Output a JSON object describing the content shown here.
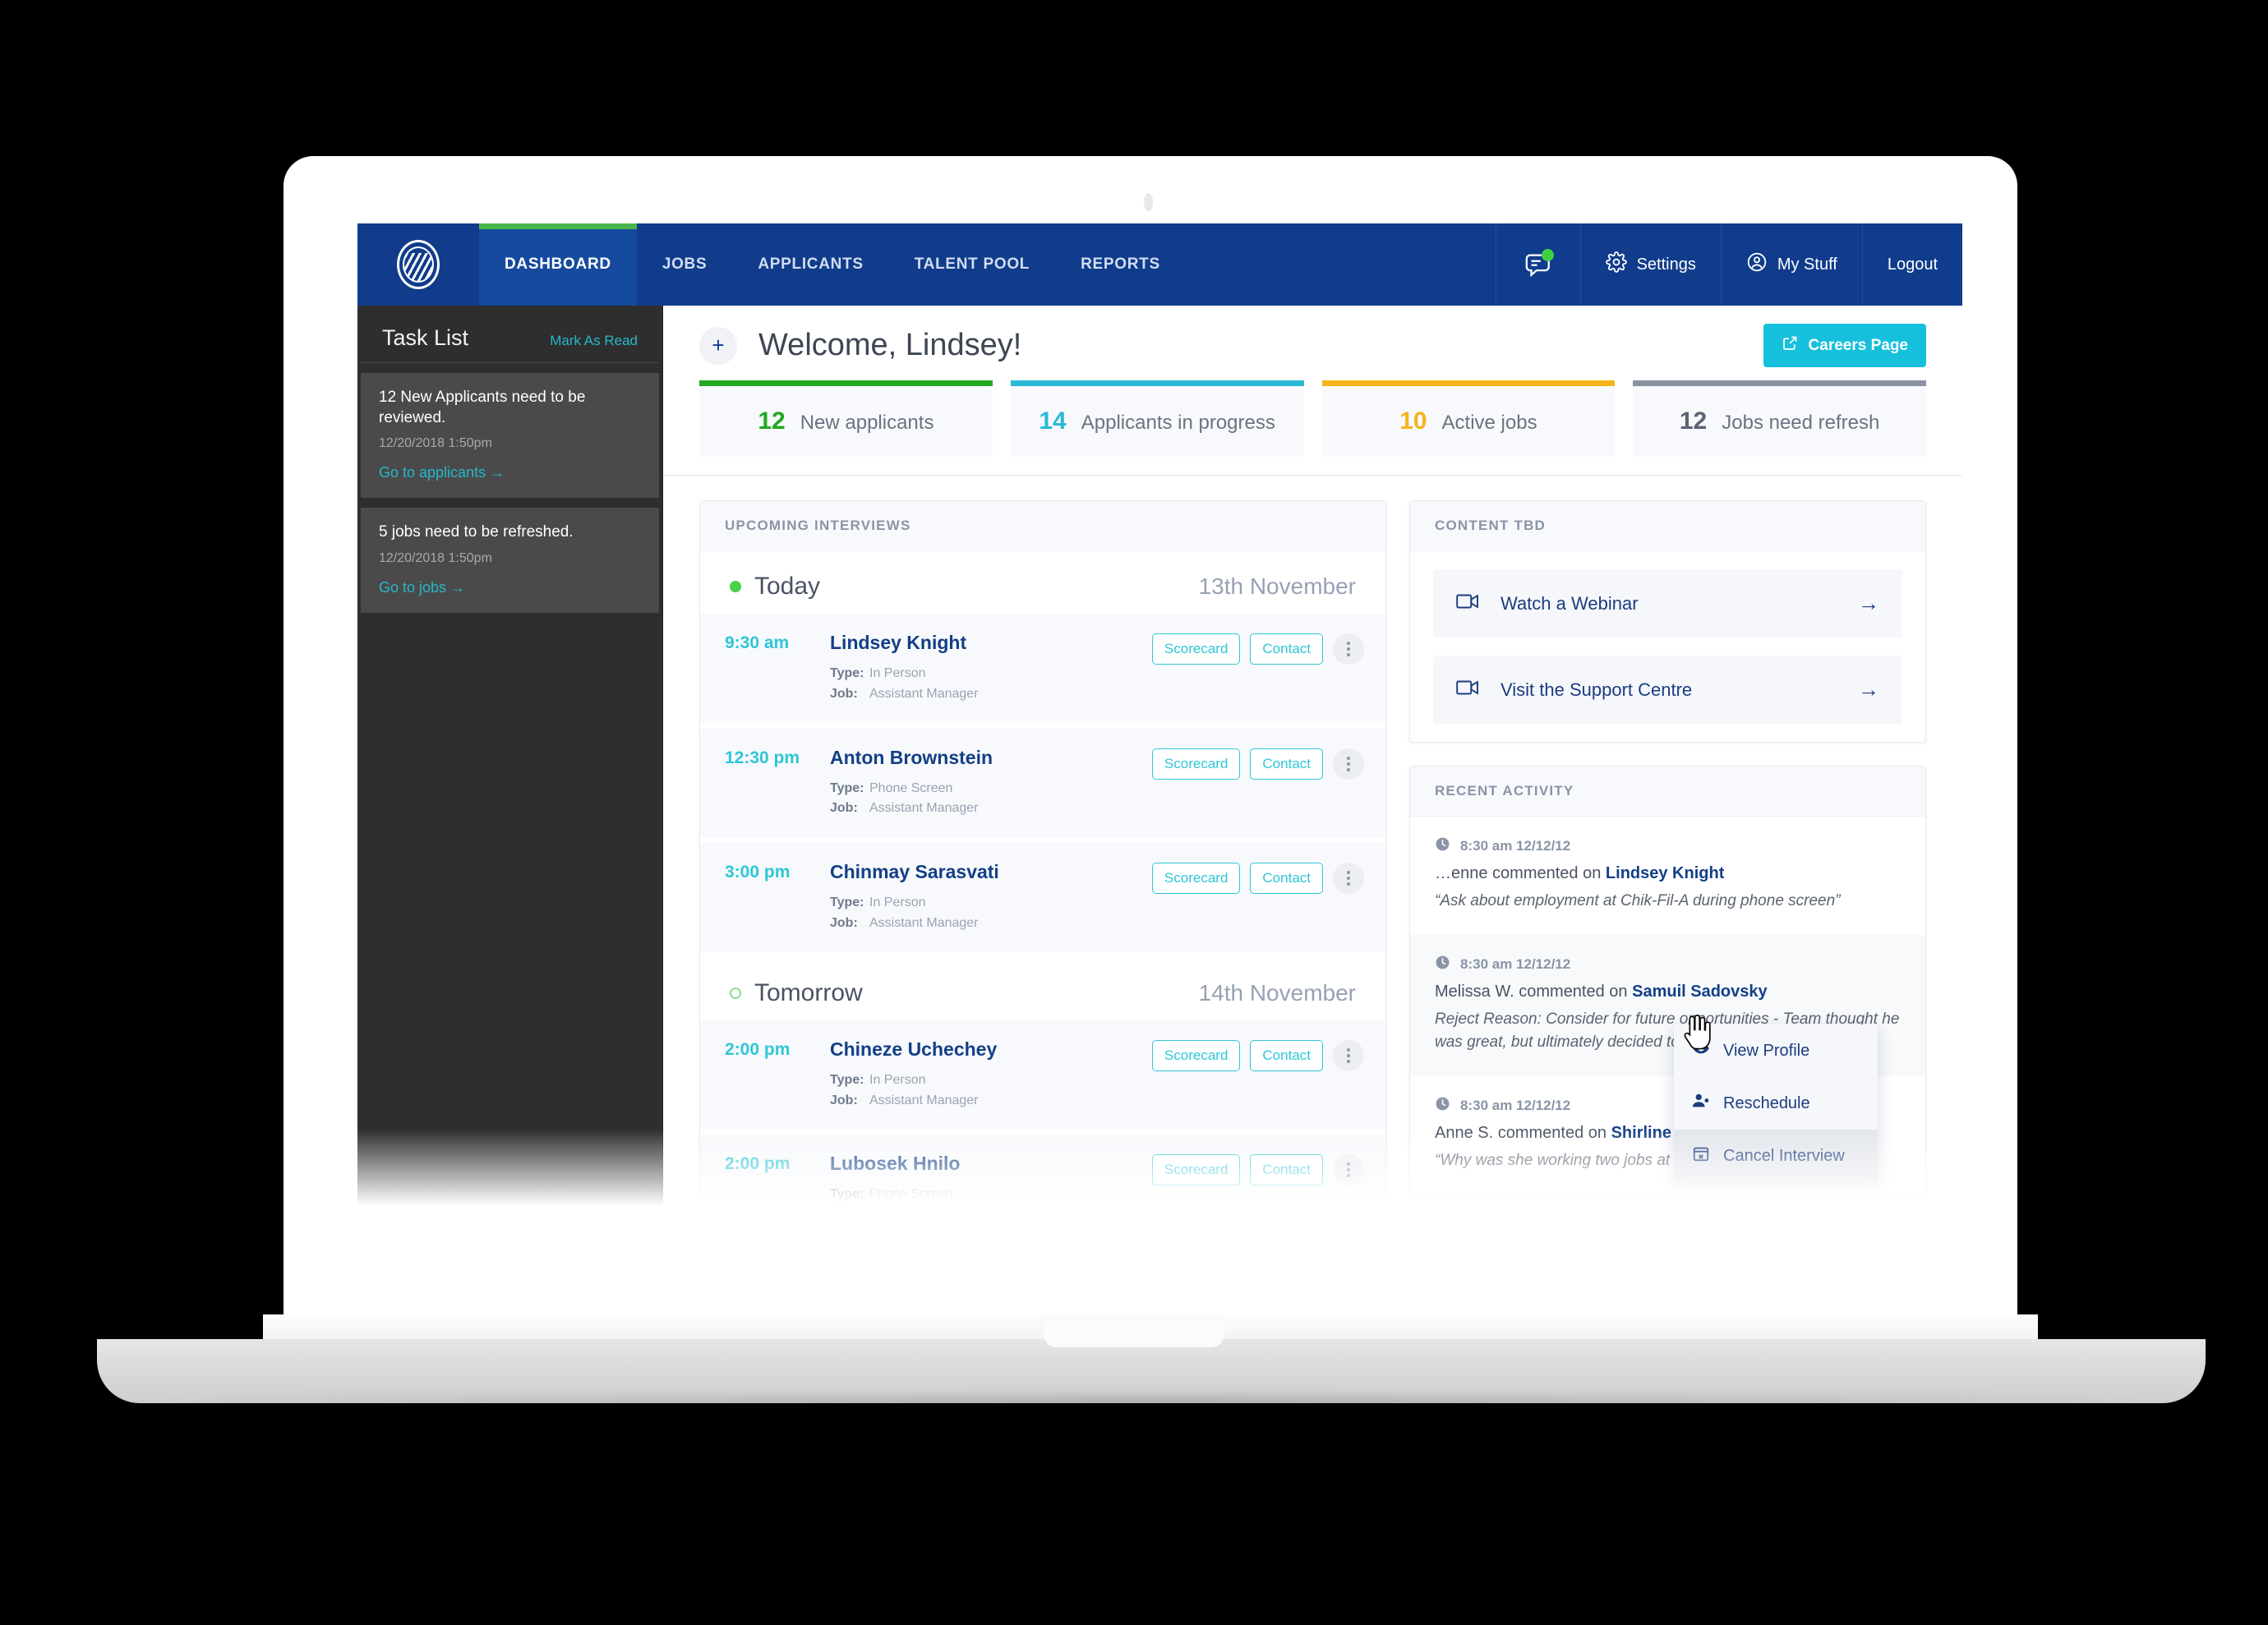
{
  "nav": {
    "logo_icon": "company-logo-icon",
    "items": [
      {
        "label": "DASHBOARD",
        "active": true
      },
      {
        "label": "JOBS",
        "active": false
      },
      {
        "label": "APPLICANTS",
        "active": false
      },
      {
        "label": "TALENT POOL",
        "active": false
      },
      {
        "label": "REPORTS",
        "active": false
      }
    ],
    "right": [
      {
        "label": "",
        "icon": "chat-bubble-icon",
        "badge": true
      },
      {
        "label": "Settings",
        "icon": "gear-icon",
        "badge": false
      },
      {
        "label": "My Stuff",
        "icon": "user-circle-icon",
        "badge": false
      },
      {
        "label": "Logout",
        "icon": "",
        "badge": false
      }
    ]
  },
  "sidebar": {
    "title": "Task List",
    "mark_as_read": "Mark As Read",
    "tasks": [
      {
        "text": "12 New Applicants need to be reviewed.",
        "date": "12/20/2018 1:50pm",
        "link": "Go to applicants →"
      },
      {
        "text": "5 jobs need to be refreshed.",
        "date": "12/20/2018 1:50pm",
        "link": "Go to jobs →"
      }
    ]
  },
  "header": {
    "add_icon": "plus-icon",
    "title": "Welcome, Lindsey!",
    "careers_button": "Careers Page",
    "careers_icon": "external-link-icon"
  },
  "stats": [
    {
      "value": "12",
      "label": "New applicants",
      "color": "#22a922"
    },
    {
      "value": "14",
      "label": "Applicants in progress",
      "color": "#2bb9d6"
    },
    {
      "value": "10",
      "label": "Active jobs",
      "color": "#f5b41a"
    },
    {
      "value": "12",
      "label": "Jobs need refresh",
      "color": "#5a6472"
    }
  ],
  "interviews": {
    "panel_title": "UPCOMING INTERVIEWS",
    "groups": [
      {
        "day": "Today",
        "date": "13th November",
        "dot": "filled",
        "rows": [
          {
            "time": "9:30 am",
            "name": "Lindsey Knight",
            "type_label": "Type:",
            "type": "In Person",
            "job_label": "Job:",
            "job": "Assistant Manager",
            "scorecard": "Scorecard",
            "contact": "Contact",
            "menu_icon": "kebab-menu-icon"
          },
          {
            "time": "12:30 pm",
            "name": "Anton Brownstein",
            "type_label": "Type:",
            "type": "Phone Screen",
            "job_label": "Job:",
            "job": "Assistant Manager",
            "scorecard": "Scorecard",
            "contact": "Contact",
            "menu_icon": "kebab-menu-icon"
          },
          {
            "time": "3:00 pm",
            "name": "Chinmay Sarasvati",
            "type_label": "Type:",
            "type": "In Person",
            "job_label": "Job:",
            "job": "Assistant Manager",
            "scorecard": "Scorecard",
            "contact": "Contact",
            "menu_icon": "kebab-menu-icon"
          }
        ]
      },
      {
        "day": "Tomorrow",
        "date": "14th November",
        "dot": "hollow",
        "rows": [
          {
            "time": "2:00 pm",
            "name": "Chineze Uchechey",
            "type_label": "Type:",
            "type": "In Person",
            "job_label": "Job:",
            "job": "Assistant Manager",
            "scorecard": "Scorecard",
            "contact": "Contact",
            "menu_icon": "kebab-menu-icon"
          },
          {
            "time": "2:00 pm",
            "name": "Lubosek Hnilo",
            "type_label": "Type:",
            "type": "Phone Screen",
            "job_label": "",
            "job": "",
            "scorecard": "Scorecard",
            "contact": "Contact",
            "menu_icon": "kebab-menu-icon"
          }
        ]
      }
    ]
  },
  "dropdown": {
    "items": [
      {
        "label": "View Profile",
        "icon": "eye-icon",
        "highlight": false
      },
      {
        "label": "Reschedule",
        "icon": "user-edit-icon",
        "highlight": false
      },
      {
        "label": "Cancel Interview",
        "icon": "calendar-cancel-icon",
        "highlight": true
      }
    ]
  },
  "content_panel": {
    "title": "CONTENT TBD",
    "items": [
      {
        "label": "Watch a Webinar",
        "icon": "video-camera-icon",
        "arrow": "→"
      },
      {
        "label": "Visit the Support Centre",
        "icon": "video-camera-icon",
        "arrow": "→"
      }
    ]
  },
  "activity_panel": {
    "title": "RECENT ACTIVITY",
    "items": [
      {
        "time": "8:30 am 12/12/12",
        "actor": "…enne",
        "verb": " commented on ",
        "subject": "Lindsey Knight",
        "quote": "“Ask about employment at Chik-Fil-A during phone screen”",
        "clock_icon": "clock-icon"
      },
      {
        "time": "8:30 am 12/12/12",
        "actor": "Melissa W.",
        "verb": " commented on ",
        "subject": "Samuil Sadovsky",
        "quote": "Reject Reason: Consider for future opportunities - Team thought he was great, but ultimately decided to go with Leslie Blasco",
        "clock_icon": "clock-icon"
      },
      {
        "time": "8:30 am 12/12/12",
        "actor": "Anne S.",
        "verb": " commented on ",
        "subject": "Shirline Dungey",
        "quote": "“Why was she working two jobs at the same time?”",
        "clock_icon": "clock-icon"
      }
    ]
  }
}
